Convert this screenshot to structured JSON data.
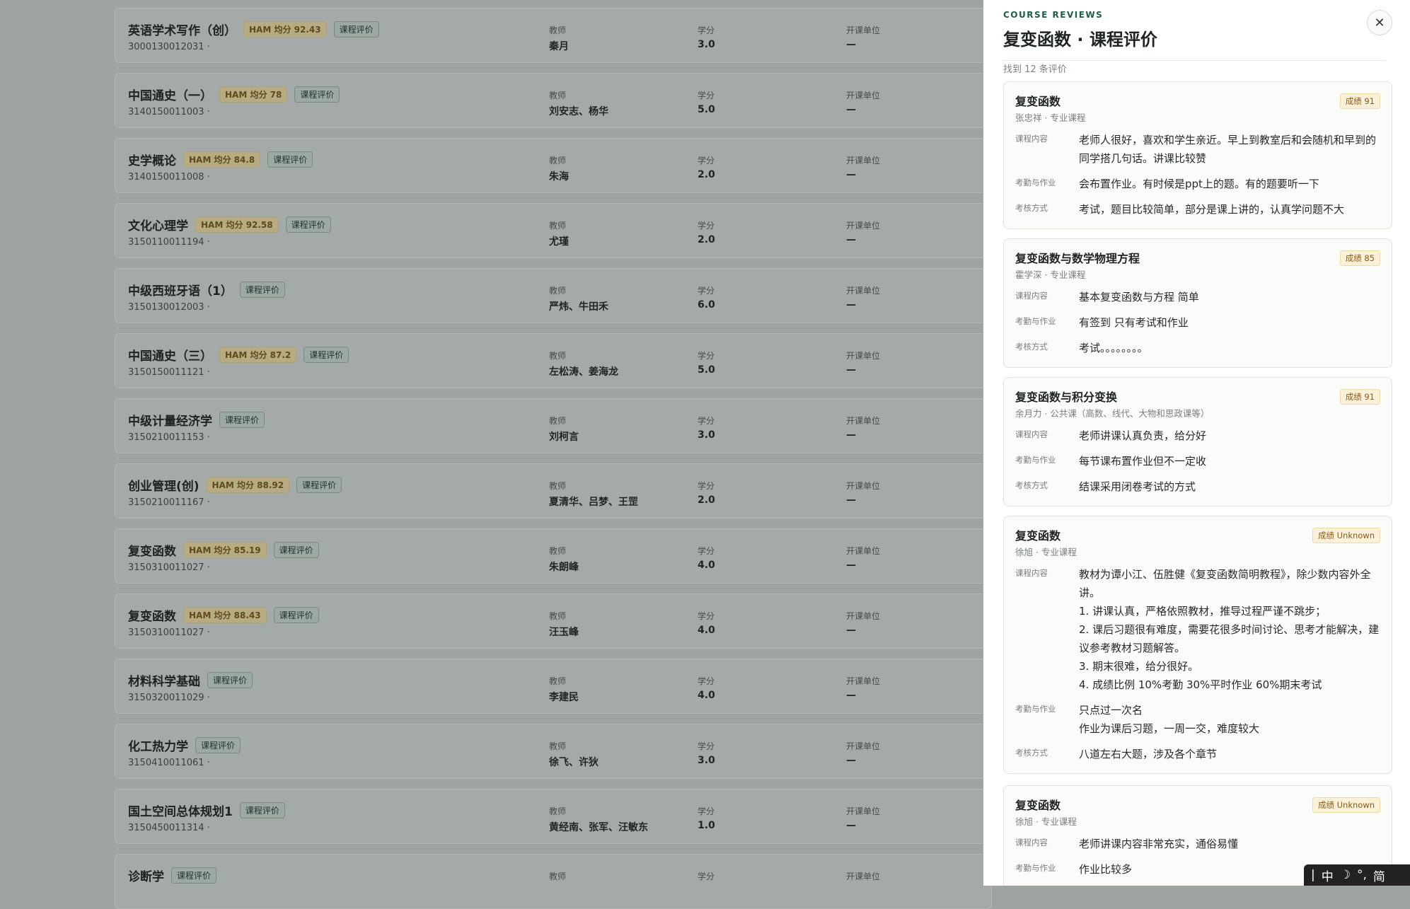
{
  "courses": [
    {
      "name": "英语学术写作（创）",
      "ham": "HAM 均分 92.43",
      "code": "3000130012031 ·",
      "teacher": "秦月",
      "credit": "3.0",
      "unit": "—"
    },
    {
      "name": "中国通史（一）",
      "ham": "HAM 均分 78",
      "code": "3140150011003 ·",
      "teacher": "刘安志、杨华",
      "credit": "5.0",
      "unit": "—"
    },
    {
      "name": "史学概论",
      "ham": "HAM 均分 84.8",
      "code": "3140150011008 ·",
      "teacher": "朱海",
      "credit": "2.0",
      "unit": "—"
    },
    {
      "name": "文化心理学",
      "ham": "HAM 均分 92.58",
      "code": "3150110011194 ·",
      "teacher": "尤瑾",
      "credit": "2.0",
      "unit": "—"
    },
    {
      "name": "中级西班牙语（1）",
      "ham": "",
      "code": "3150130012003 ·",
      "teacher": "严炜、牛田禾",
      "credit": "6.0",
      "unit": "—"
    },
    {
      "name": "中国通史（三）",
      "ham": "HAM 均分 87.2",
      "code": "3150150011121 ·",
      "teacher": "左松涛、姜海龙",
      "credit": "5.0",
      "unit": "—"
    },
    {
      "name": "中级计量经济学",
      "ham": "",
      "code": "3150210011153 ·",
      "teacher": "刘柯言",
      "credit": "3.0",
      "unit": "—"
    },
    {
      "name": "创业管理(创)",
      "ham": "HAM 均分 88.92",
      "code": "3150210011167 ·",
      "teacher": "夏清华、吕梦、王罡",
      "credit": "2.0",
      "unit": "—"
    },
    {
      "name": "复变函数",
      "ham": "HAM 均分 85.19",
      "code": "3150310011027 ·",
      "teacher": "朱朗峰",
      "credit": "4.0",
      "unit": "—"
    },
    {
      "name": "复变函数",
      "ham": "HAM 均分 88.43",
      "code": "3150310011027 ·",
      "teacher": "汪玉峰",
      "credit": "4.0",
      "unit": "—"
    },
    {
      "name": "材料科学基础",
      "ham": "",
      "code": "3150320011029 ·",
      "teacher": "李建民",
      "credit": "4.0",
      "unit": "—"
    },
    {
      "name": "化工热力学",
      "ham": "",
      "code": "3150410011061 ·",
      "teacher": "徐飞、许狄",
      "credit": "3.0",
      "unit": "—"
    },
    {
      "name": "国土空间总体规划1",
      "ham": "",
      "code": "3150450011314 ·",
      "teacher": "黄经南、张军、汪敏东",
      "credit": "1.0",
      "unit": "—"
    },
    {
      "name": "诊断学",
      "ham": "",
      "code": "",
      "teacher": "",
      "credit": "",
      "unit": ""
    }
  ],
  "labels": {
    "review_chip": "课程评价",
    "teacher": "教师",
    "credit": "学分",
    "unit": "开课单位",
    "content": "课程内容",
    "attendance": "考勤与作业",
    "assessment": "考核方式"
  },
  "drawer": {
    "kicker": "COURSE REVIEWS",
    "title": "复变函数 · 课程评价",
    "close": "✕",
    "count": "找到 12 条评价"
  },
  "reviews": [
    {
      "name": "复变函数",
      "meta": "张忠祥 · 专业课程",
      "grade": "成绩 91",
      "content": "老师人很好，喜欢和学生亲近。早上到教室后和会随机和早到的同学搭几句话。讲课比较赞",
      "attendance": "会布置作业。有时候是ppt上的题。有的题要听一下",
      "assessment": "考试，题目比较简单，部分是课上讲的，认真学问题不大"
    },
    {
      "name": "复变函数与数学物理方程",
      "meta": "霍学深 · 专业课程",
      "grade": "成绩 85",
      "content": "基本复变函数与方程 简单",
      "attendance": "有签到 只有考试和作业",
      "assessment": "考试。。。。。。。。"
    },
    {
      "name": "复变函数与积分变换",
      "meta": "余月力 · 公共课（高数、线代、大物和思政课等）",
      "grade": "成绩 91",
      "content": "老师讲课认真负责，给分好",
      "attendance": "每节课布置作业但不一定收",
      "assessment": "结课采用闭卷考试的方式"
    },
    {
      "name": "复变函数",
      "meta": "徐旭 · 专业课程",
      "grade": "成绩 Unknown",
      "content": "教材为谭小江、伍胜健《复变函数简明教程》，除少数内容外全讲。\n1. 讲课认真，严格依照教材，推导过程严谨不跳步；\n2. 课后习题很有难度，需要花很多时间讨论、思考才能解决，建议参考教材习题解答。\n3. 期末很难，给分很好。\n4. 成绩比例 10%考勤 30%平时作业 60%期末考试",
      "attendance": "只点过一次名\n作业为课后习题，一周一交，难度较大",
      "assessment": "八道左右大题，涉及各个章节"
    },
    {
      "name": "复变函数",
      "meta": "徐旭 · 专业课程",
      "grade": "成绩 Unknown",
      "content": "老师讲课内容非常充实，通俗易懂",
      "attendance": "作业比较多",
      "assessment": ""
    }
  ],
  "ime": {
    "items": [
      "|",
      "中",
      "☽",
      "°,",
      "简"
    ]
  }
}
